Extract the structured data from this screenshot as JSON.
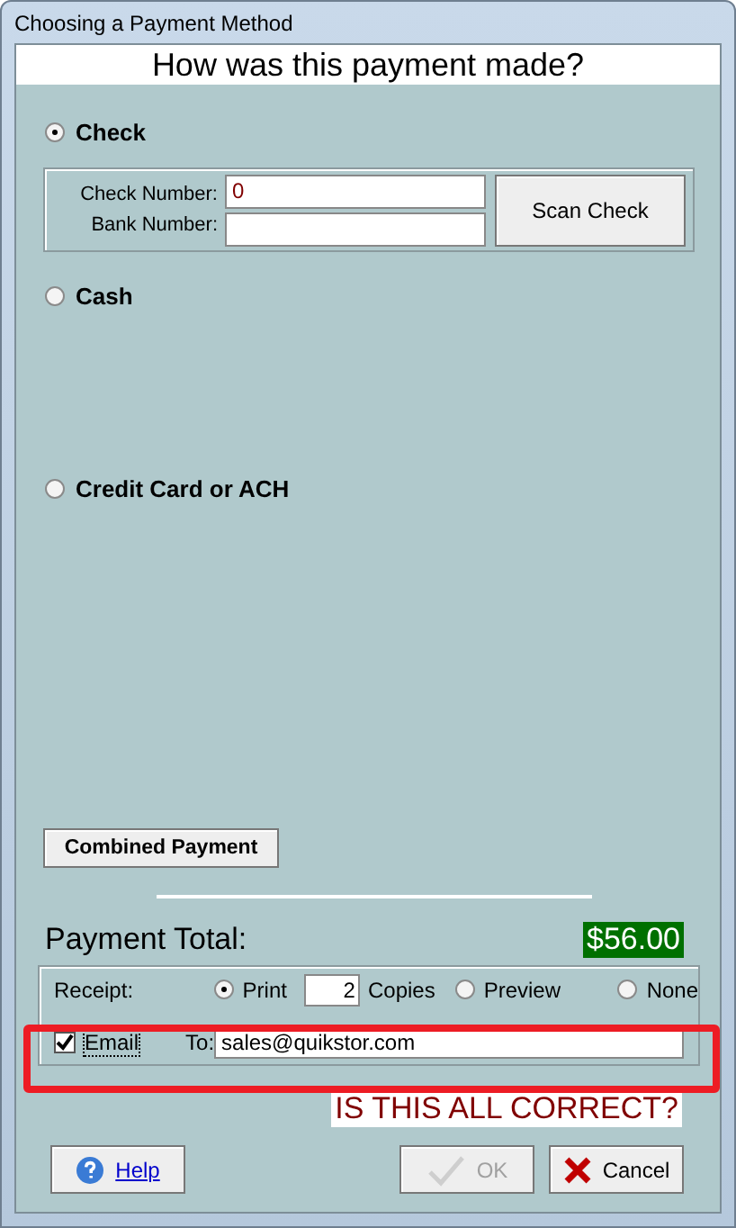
{
  "window": {
    "title": "Choosing a Payment Method"
  },
  "heading": "How was this payment made?",
  "methods": [
    {
      "label": "Check",
      "selected": true
    },
    {
      "label": "Cash",
      "selected": false
    },
    {
      "label": "Credit Card or ACH",
      "selected": false
    }
  ],
  "check_details": {
    "check_number_label": "Check Number:",
    "check_number": "0",
    "bank_number_label": "Bank Number:",
    "scan_button": "Scan Check"
  },
  "combined_button": "Combined Payment",
  "total": {
    "label": "Payment Total:",
    "amount": "$56.00"
  },
  "receipt": {
    "label": "Receipt:",
    "options": [
      {
        "label": "Print",
        "selected": true
      },
      {
        "label": "Preview",
        "selected": false
      },
      {
        "label": "None",
        "selected": false
      }
    ],
    "copies": "2",
    "copies_label": "Copies",
    "email": {
      "label": "Email",
      "checked": true
    },
    "to_label": "To:",
    "to": "sales@quikstor.com"
  },
  "prompt": "IS THIS ALL CORRECT?",
  "buttons": [
    {
      "label": "Help",
      "kind": "help",
      "disabled": false
    },
    {
      "label": "OK",
      "kind": "ok",
      "disabled": true
    },
    {
      "label": "Cancel",
      "kind": "cancel",
      "disabled": false
    }
  ]
}
